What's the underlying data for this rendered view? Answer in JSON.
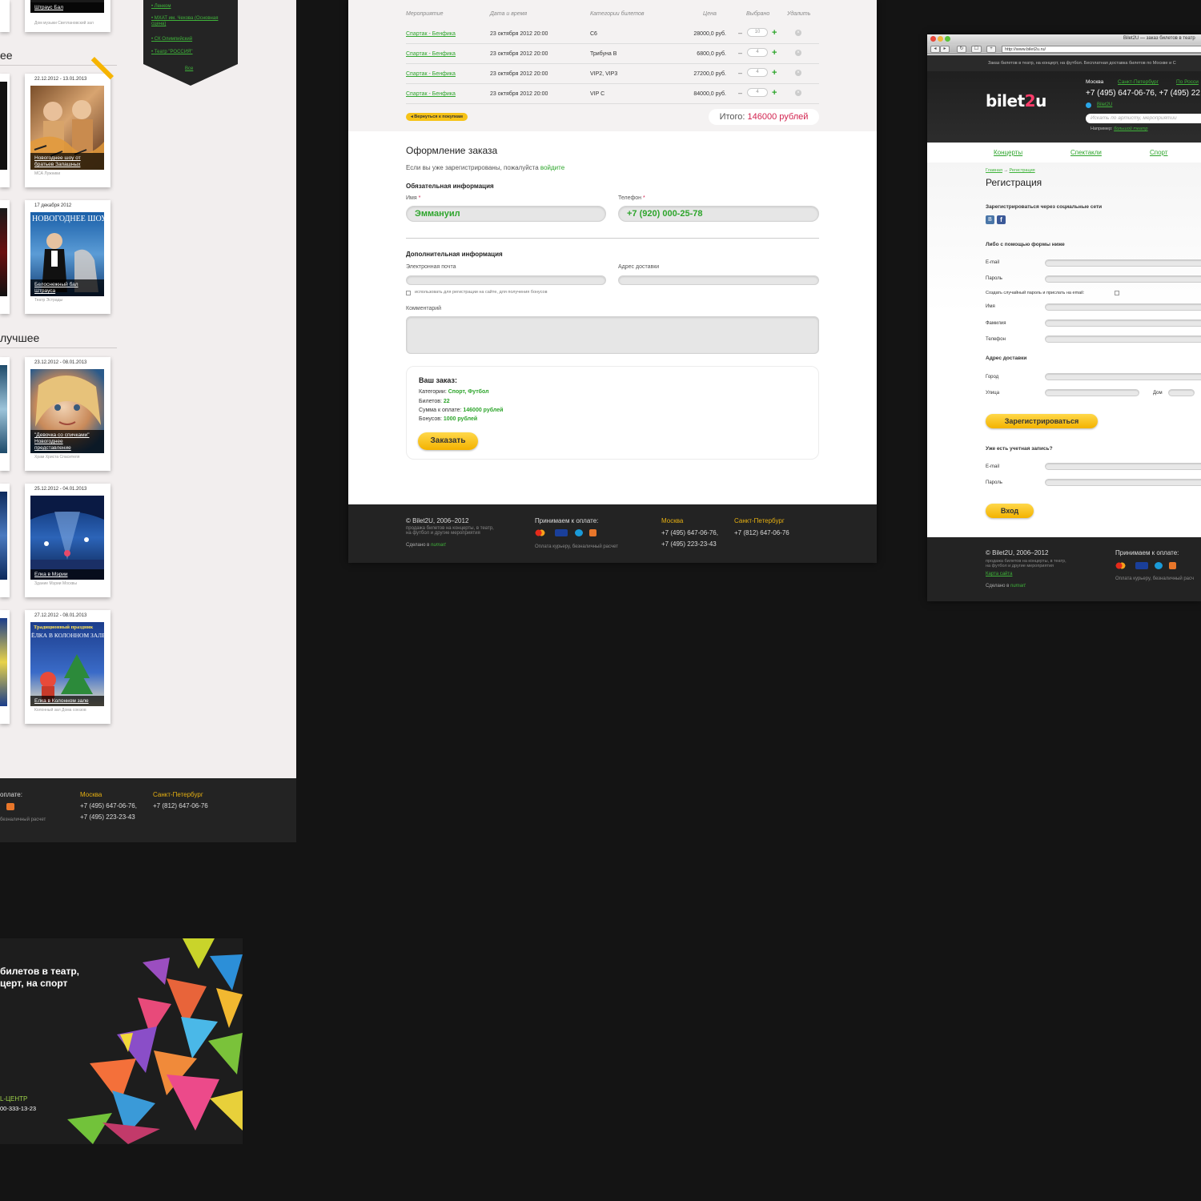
{
  "left": {
    "top_card_caption": "Штраус Бал",
    "top_card_venue": "Дом музыки Светлановский зал",
    "heading_new": "ее",
    "heading_best": "лучшее",
    "cards": [
      {
        "date": "22.12.2012 - 13.01.2013",
        "caption": "Новогоднее шоу от братьев Запашных",
        "venue": "МСА Лужники"
      },
      {
        "date": "17 декабря 2012",
        "caption": "Белоснежный бал Штрауса",
        "venue": "Театр Эстрады",
        "poster_title": "НОВОГОДНЕЕ ШОУ"
      },
      {
        "date": "23.12.2012 - 08.01.2013",
        "caption": "\"Девочка со спичками\" Новогоднее представление",
        "venue": "Храм Христа Спасителя"
      },
      {
        "date": "25.12.2012 - 04.01.2013",
        "caption": "Елка в Мэрии",
        "venue": "Здание Мэрии Москвы"
      },
      {
        "date": "27.12.2012 - 08.01.2013",
        "caption": "Елка в Колонном зале",
        "venue": "Колонный зал Дома союзов",
        "poster_title": "Традиционный праздник",
        "poster_sub": "ЁЛКА В КОЛОННОМ ЗАЛЕ"
      }
    ],
    "menu": {
      "items": [
        "Ленком",
        "МХАТ им. Чехова (Основная сцена)",
        "СК Олимпийский",
        "Театр \"РОССИЯ\""
      ],
      "all": "Все"
    },
    "footer": {
      "payment_partial": "оплате:",
      "payment_note_partial": "безналичный расчет",
      "moscow": "Москва",
      "spb": "Санкт-Петербург",
      "phone1": "+7 (495) 647-06-76,",
      "phone2": "+7 (495) 223-23-43",
      "phone_spb": "+7 (812) 647-06-76"
    }
  },
  "cart": {
    "headers": [
      "Мероприятие",
      "Дата и время",
      "Категории билетов",
      "Цена",
      "Выбрано",
      "Удалить"
    ],
    "rows": [
      {
        "event": "Спартак - Бенфика",
        "date": "23 октября 2012 20:00",
        "category": "C6",
        "price": "28000,0 руб.",
        "qty": "10"
      },
      {
        "event": "Спартак - Бенфика",
        "date": "23 октября 2012 20:00",
        "category": "Трибуна B",
        "price": "6800,0 руб.",
        "qty": "4"
      },
      {
        "event": "Спартак - Бенфика",
        "date": "23 октября 2012 20:00",
        "category": "VIP2, VIP3",
        "price": "27200,0 руб.",
        "qty": "4"
      },
      {
        "event": "Спартак - Бенфика",
        "date": "23 октября 2012 20:00",
        "category": "VIP C",
        "price": "84000,0 руб.",
        "qty": "4"
      }
    ],
    "back": "◂ Вернуться к покупкам",
    "total_label": "Итого: ",
    "total_value": "146000 рублей"
  },
  "checkout": {
    "title": "Оформление заказа",
    "login_prompt": "Если вы уже зарегистрированы, пожалуйста ",
    "login_link": "войдите",
    "required_title": "Обязательная информация",
    "name_label": "Имя",
    "name_value": "Эммануил",
    "phone_label": "Телефон",
    "phone_value": "+7 (920) 000-25-78",
    "extra_title": "Дополнительная информация",
    "email_label": "Электронная почта",
    "address_label": "Адрес доставки",
    "checkbox_label": "использовать для регистрации на сайте, для получения бонусов",
    "comment_label": "Комментарий",
    "order": {
      "title": "Ваш заказ:",
      "categories_label": "Категории: ",
      "categories": "Спорт, Футбол",
      "tickets_label": "Билетов: ",
      "tickets": "22",
      "sum_label": "Сумма к оплате: ",
      "sum": "146000 рублей",
      "bonus_label": "Бонусов: ",
      "bonus": "1000 рублей",
      "button": "Заказать"
    }
  },
  "center_footer": {
    "copyright": "© Bilet2U, 2006–2012",
    "desc1": "продажа билетов на концерты, в театр,",
    "desc2": "на футбол и другие мероприятия",
    "made_by": "Сделано в ",
    "made_by_brand": "numart",
    "payment_title": "Принимаем к оплате:",
    "payment_note": "Оплата курьеру, безналичный расчет",
    "moscow": "Москва",
    "spb": "Санкт-Петербург",
    "phone1": "+7 (495) 647-06-76,",
    "phone2": "+7 (495) 223-23-43",
    "phone_spb": "+7 (812) 647-06-76"
  },
  "browser": {
    "window_title": "Bilet2U — заказ билетов в театр",
    "url": "http://www.bilet2u.ru/",
    "tagline": "Заказ билетов в театр, на концерт, на футбол. Бесплатная доставка билетов по Москве и С",
    "logo_a": "bilet",
    "logo_b": "2",
    "logo_c": "u",
    "city_moscow": "Москва",
    "city_spb": "Санкт-Петербург",
    "city_more": "По Росси",
    "phones": "+7 (495) 647-06-76, +7 (495) 22",
    "skype": "Bilet2U",
    "search_placeholder": "Искать по артисту, мероприятиu",
    "example_label": "Например: ",
    "example_link": "большой театр",
    "nav": [
      "Концерты",
      "Спектакли",
      "Спорт"
    ],
    "breadcrumb_home": "Главная",
    "breadcrumb_arrow": " → ",
    "breadcrumb_current": "Регистрация",
    "title": "Регистрация",
    "social_title": "Зарегистрироваться через социальные сети",
    "form_title": "Либо с помощью формы ниже",
    "labels": {
      "email": "E-mail",
      "password": "Пароль",
      "random_pw": "Создать случайный пароль и прислать на email:",
      "name": "Имя",
      "surname": "Фамилия",
      "phone": "Телефон",
      "address_title": "Адрес доставки",
      "city": "Город",
      "street": "Улица",
      "house": "Дом"
    },
    "register_button": "Зарегистрироваться",
    "have_account": "Уже есть учетная запись?",
    "login_email": "E-mail",
    "login_password": "Пароль",
    "login_button": "Вход",
    "footer": {
      "copyright": "© Bilet2U, 2006–2012",
      "desc1": "продажа билетов на концерты, в театр,",
      "desc2": "на футбол и другие мероприятия",
      "sitemap": "Карта сайта",
      "made_by": "Сделано в ",
      "made_by_brand": "numart",
      "payment_title": "Принимаем к оплате:",
      "payment_note": "Оплата курьеру, безналичный расч"
    }
  },
  "banner": {
    "line1": "билетов в театр,",
    "line2": "церт, на спорт",
    "callcenter": "L-ЦЕНТР",
    "phone": "00-333-13-23"
  }
}
